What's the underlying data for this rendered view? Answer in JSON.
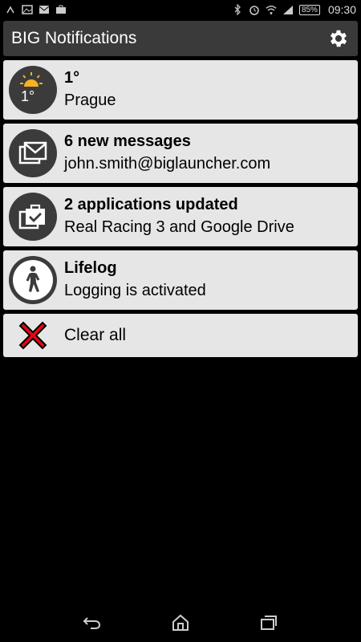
{
  "status_bar": {
    "battery": "85%",
    "time": "09:30",
    "left_icons": [
      "missed-call-icon",
      "image-icon",
      "mail-icon",
      "briefcase-icon"
    ],
    "right_icons": [
      "bluetooth-icon",
      "alarm-icon",
      "wifi-icon",
      "signal-icon"
    ]
  },
  "app": {
    "title": "BIG Notifications",
    "settings_icon": "gear-icon"
  },
  "notifications": [
    {
      "icon": "weather-sun-icon",
      "title": "1°",
      "subtitle": "Prague",
      "temp": "1°"
    },
    {
      "icon": "messages-icon",
      "title": "6 new messages",
      "subtitle": "john.smith@biglauncher.com"
    },
    {
      "icon": "apps-updated-icon",
      "title": "2 applications updated",
      "subtitle": "Real Racing 3 and Google Drive"
    },
    {
      "icon": "walking-icon",
      "title": "Lifelog",
      "subtitle": "Logging is activated"
    }
  ],
  "clear_all": {
    "label": "Clear all",
    "icon": "red-x-icon"
  },
  "nav_bar": {
    "buttons": [
      "back-icon",
      "home-icon",
      "recent-apps-icon"
    ]
  },
  "colors": {
    "card": "#e6e6e6",
    "actionbar": "#3a3a3a",
    "circle": "#3b3b3b",
    "accent_red": "#e30613",
    "sun": "#f5b324"
  }
}
